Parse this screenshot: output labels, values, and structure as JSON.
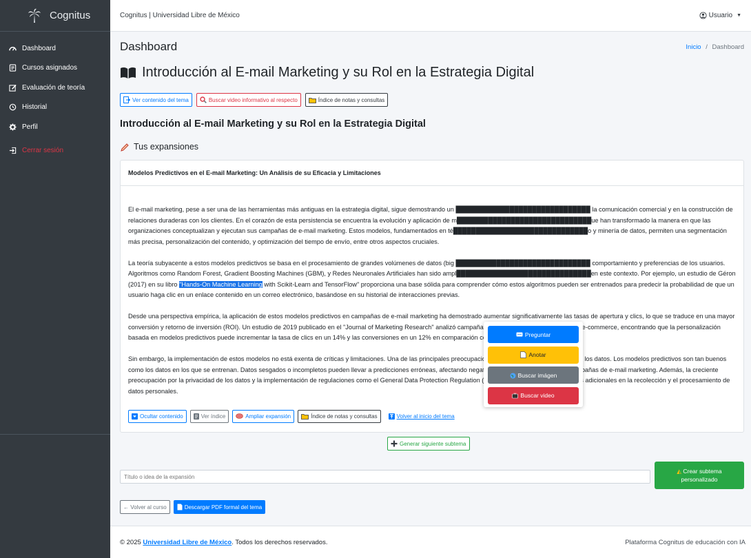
{
  "brand": {
    "name": "Cognitus"
  },
  "sidebar": {
    "items": [
      {
        "label": "Dashboard",
        "icon": "dashboard-icon"
      },
      {
        "label": "Cursos asignados",
        "icon": "courses-icon"
      },
      {
        "label": "Evaluación de teoría",
        "icon": "edit-icon"
      },
      {
        "label": "Historial",
        "icon": "history-icon"
      },
      {
        "label": "Perfil",
        "icon": "gear-icon"
      },
      {
        "label": "Cerrar sesión",
        "icon": "logout-icon"
      }
    ]
  },
  "topbar": {
    "site": "Cognitus | Universidad Libre de México",
    "user": "Usuario"
  },
  "page": {
    "title": "Dashboard",
    "breadcrumb_home": "Inicio",
    "breadcrumb_sep": "/",
    "breadcrumb_current": "Dashboard"
  },
  "topic": {
    "title": "Introducción al E-mail Marketing y su Rol en la Estrategia Digital",
    "buttons": {
      "ver": "Ver contenido del tema",
      "buscar": "Buscar video informativo al respecto",
      "indice": "Índice de notas y consultas"
    },
    "subtitle": "Introducción al E-mail Marketing y su Rol en la Estrategia Digital",
    "expansions_label": "Tus expansiones"
  },
  "card": {
    "title": "Modelos Predictivos en el E-mail Marketing: Un Análisis de su Eficacia y Limitaciones",
    "p1": "El e-mail marketing, pese a ser una de las herramientas más antiguas en la estrategia digital, sigue demostrando un ██████████████████████████████ la comunicación comercial y en la construcción de relaciones duraderas con los clientes. En el corazón de esta persistencia se encuentra la evolución y aplicación de m██████████████████████████████ue han transformado la manera en que las organizaciones conceptualizan y ejecutan sus campañas de e-mail marketing. Estos modelos, fundamentados en té██████████████████████████████o y minería de datos, permiten una segmentación más precisa, personalización del contenido, y optimización del tiempo de envío, entre otros aspectos cruciales.",
    "p2_before": "La teoría subyacente a estos modelos predictivos se basa en el procesamiento de grandes volúmenes de datos (big ██████████████████████████████ comportamiento y preferencias de los usuarios. Algoritmos como Random Forest, Gradient Boosting Machines (GBM), y Redes Neuronales Artificiales han sido ampl██████████████████████████████en este contexto. Por ejemplo, un estudio de Géron (2017) en su libro ",
    "p2_highlight": "\"Hands-On Machine Learning",
    "p2_after": " with Scikit-Learn and TensorFlow\" proporciona una base sólida para comprender cómo estos algoritmos pueden ser entrenados para predecir la probabilidad de que un usuario haga clic en un enlace contenido en un correo electrónico, basándose en su historial de interacciones previas.",
    "p3": "Desde una perspectiva empírica, la aplicación de estos modelos predictivos en campañas de e-mail marketing ha demostrado aumentar significativamente las tasas de apertura y clics, lo que se traduce en una mayor conversión y retorno de inversión (ROI). Un estudio de 2019 publicado en el \"Journal of Marketing Research\" analizó campañas de e-mail de varias empresas de e-commerce, encontrando que la personalización basada en modelos predictivos puede incrementar la tasa de clics en un 14% y las conversiones en un 12% en comparación con métodos más tradicionales.",
    "p4": "Sin embargo, la implementación de estos modelos no está exenta de críticas y limitaciones. Una de las principales preocupaciones es la calidad y la integridad de los datos. Los modelos predictivos son tan buenos como los datos en los que se entrenan. Datos sesgados o incompletos pueden llevar a predicciones erróneas, afectando negativamente la efectividad de las campañas de e-mail marketing. Además, la creciente preocupación por la privacidad de los datos y la implementación de regulaciones como el General Data Protection Regulation (GDPR) en Europa plantea desafíos adicionales en la recolección y el procesamiento de datos personales.",
    "buttons": {
      "ocultar": "Ocultar contenido",
      "ver_indice": "Ver índice",
      "ampliar": "Ampliar expansión",
      "indice": "Índice de notas y consultas",
      "volver": "Volver al inicio del tema"
    }
  },
  "popup": {
    "preguntar": "Preguntar",
    "anotar": "Anotar",
    "buscar_imagen": "Buscar imágen",
    "buscar_video": "Buscar video"
  },
  "generar": "Generar siguiente subtema",
  "expansion_input": {
    "placeholder": "Título o idea de la expansión"
  },
  "crear": {
    "line1": "Crear subtema",
    "line2": "personalizado"
  },
  "bottom": {
    "volver": "← Volver al curso",
    "descargar": "Descargar PDF formal del tema"
  },
  "footer": {
    "prefix": "© 2025 ",
    "org": "Universidad Libre de México",
    "suffix": ". Todos los derechos reservados.",
    "right": "Plataforma Cognitus de educación con IA"
  },
  "colors": {
    "sidebar": "#343a40",
    "primary": "#007bff",
    "danger": "#dc3545",
    "warning": "#ffc107",
    "success": "#28a745",
    "secondary": "#6c757d"
  }
}
